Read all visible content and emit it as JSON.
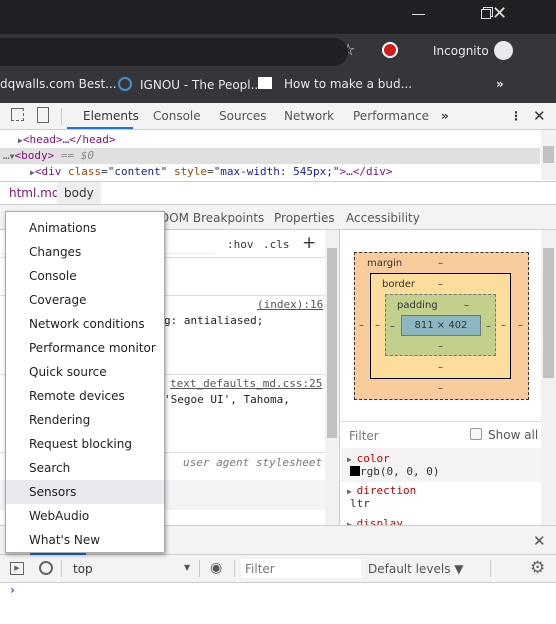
{
  "window": {
    "controls": [
      "minimize",
      "restore",
      "close"
    ]
  },
  "toolbar": {
    "profile_label": "Incognito",
    "icons": [
      "star-icon",
      "extension-icon",
      "incognito-icon",
      "menu-icon"
    ]
  },
  "bookmarks": [
    {
      "label": "dqwalls.com Best..."
    },
    {
      "label": "IGNOU - The Peopl..."
    },
    {
      "label": "How to make a bud..."
    }
  ],
  "devtools": {
    "tabs": [
      "Elements",
      "Console",
      "Sources",
      "Network",
      "Performance"
    ],
    "active_tab": "Elements",
    "tree": {
      "head": "<head>…</head>",
      "body": "<body>",
      "body_marker": "== $0",
      "div_tag": "<div",
      "div_attr1": "class",
      "div_val1": "\"content\"",
      "div_attr2": "style",
      "div_val2": "\"max-width: 545px;\"",
      "div_end": ">…</div>"
    },
    "breadcrumbs": [
      "html.md",
      "body"
    ],
    "subtabs": [
      "DOM Breakpoints",
      "Properties",
      "Accessibility"
    ],
    "styles": {
      "hov": ":hov",
      "cls": ".cls",
      "add": "+",
      "rule1_source": "(index):16",
      "rule1_text": "g: antialiased;",
      "rule2_source": "text_defaults_md.css:25",
      "rule2_text": "'Segoe UI', Tahoma,",
      "rule3_source": "user agent stylesheet"
    },
    "boxmodel": {
      "margin": "margin",
      "border": "border",
      "padding": "padding",
      "content": "811 × 402",
      "dash": "–"
    },
    "computed": {
      "filter_placeholder": "Filter",
      "show_all": "Show all",
      "props": [
        {
          "name": "color",
          "value": "rgb(0, 0, 0)"
        },
        {
          "name": "direction",
          "value": "ltr"
        },
        {
          "name": "display",
          "value": ""
        }
      ]
    },
    "more_tools_menu": {
      "items": [
        "Animations",
        "Changes",
        "Console",
        "Coverage",
        "Network conditions",
        "Performance monitor",
        "Quick source",
        "Remote devices",
        "Rendering",
        "Request blocking",
        "Search",
        "Sensors",
        "WebAudio",
        "What's New"
      ],
      "highlighted": "Sensors"
    },
    "console": {
      "context": "top",
      "filter_placeholder": "Filter",
      "levels": "Default levels ▼",
      "prompt": "›"
    }
  },
  "colors": {
    "accent": "#1a73e8",
    "chrome_dark": "#202124",
    "chrome_toolbar": "#35363a",
    "margin": "#f9cc9d",
    "border": "#fddd9b",
    "padding": "#c3d08b",
    "content": "#8cb6c0"
  }
}
